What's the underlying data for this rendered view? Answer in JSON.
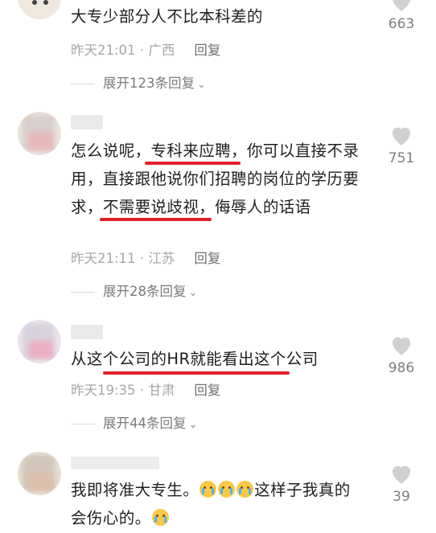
{
  "comments": [
    {
      "text": "大专少部分人不比本科差的",
      "time": "昨天21:01",
      "location": "广西",
      "reply_label": "回复",
      "expand_label": "展开123条回复",
      "likes": "663"
    },
    {
      "text_parts": [
        "怎么说呢，",
        "专科来应聘",
        "，你可以直接不录用，直接跟他说你们招聘的岗位的学历要求，",
        "不需要说歧视",
        "，侮辱人的话语"
      ],
      "time": "昨天21:11",
      "location": "江苏",
      "reply_label": "回复",
      "expand_label": "展开28条回复",
      "likes": "751"
    },
    {
      "text": "从这个公司的HR就能看出这个公司",
      "time": "昨天19:35",
      "location": "甘肃",
      "reply_label": "回复",
      "expand_label": "展开44条回复",
      "likes": "986"
    },
    {
      "text_parts": [
        "我即将准大专生。",
        "这样子我真的会伤心的。"
      ],
      "likes": "39"
    }
  ],
  "separator": " · ",
  "highlight_color": "#e0212a",
  "icons": {
    "like": "heart-icon",
    "expand": "chevron-down-icon",
    "emoji": "crying-face-emoji"
  }
}
